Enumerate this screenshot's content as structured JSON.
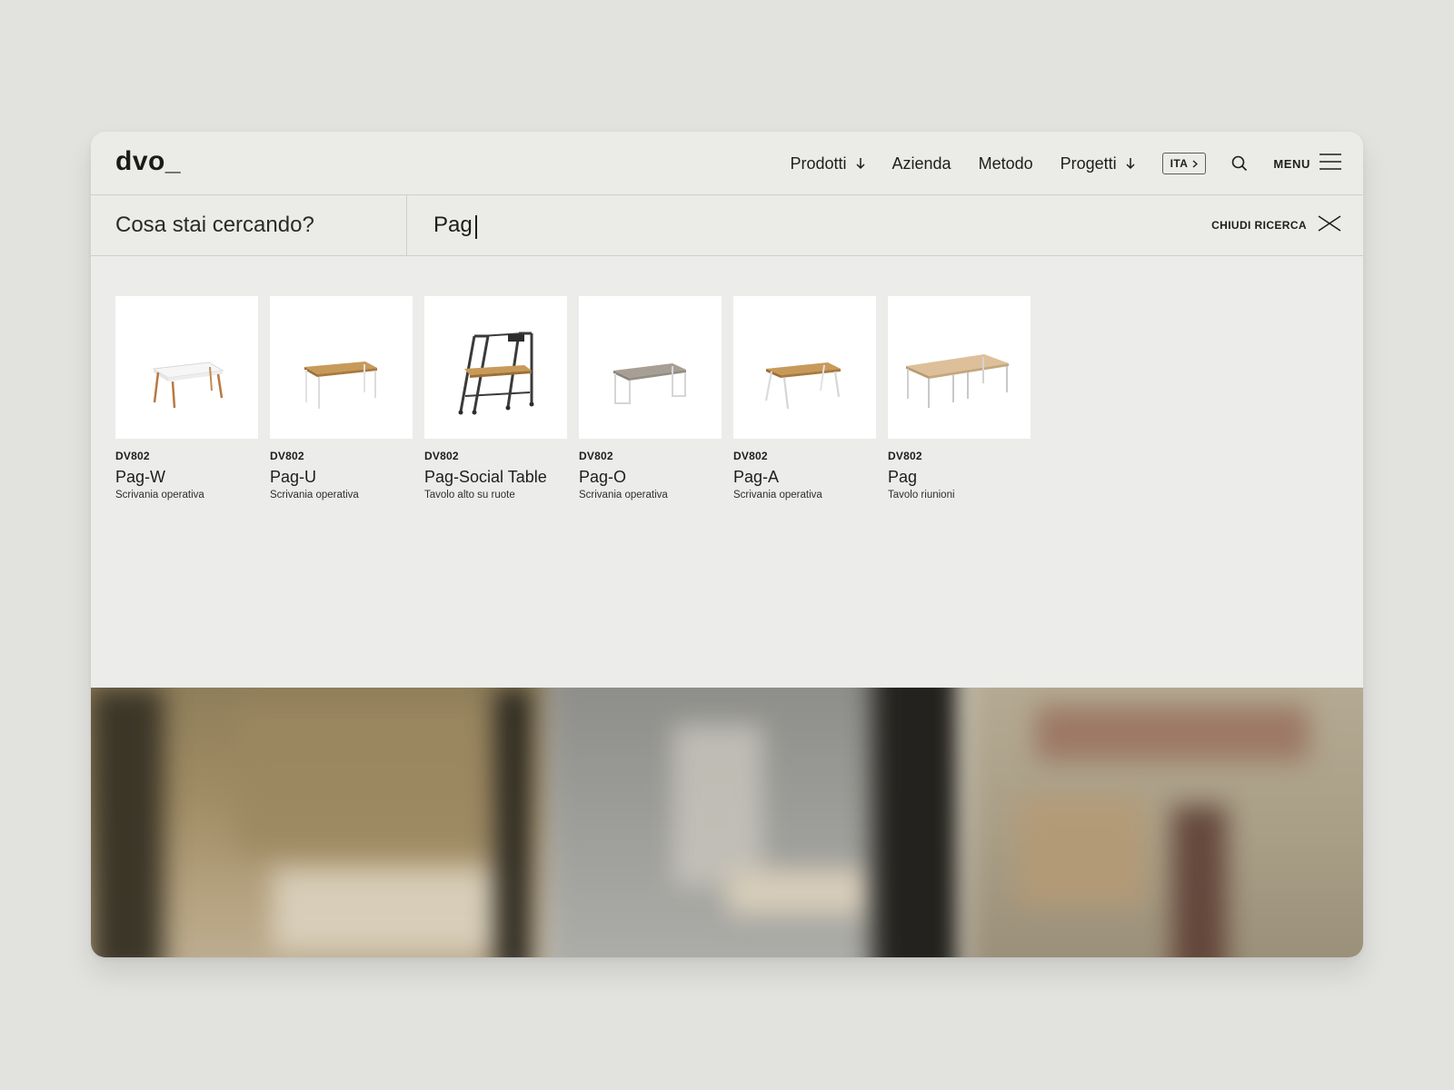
{
  "brand": {
    "logo": "dvo_"
  },
  "nav": {
    "items": [
      {
        "label": "Prodotti",
        "has_dropdown": true,
        "icon": "arrow-down-icon"
      },
      {
        "label": "Azienda",
        "has_dropdown": false
      },
      {
        "label": "Metodo",
        "has_dropdown": false
      },
      {
        "label": "Progetti",
        "has_dropdown": true,
        "icon": "arrow-down-icon"
      }
    ],
    "language": "ITA",
    "search_icon": "search-icon",
    "menu_label": "MENU",
    "menu_icon": "hamburger-icon"
  },
  "search": {
    "prompt": "Cosa stai cercando?",
    "query": "Pag",
    "close_label": "CHIUDI RICERCA",
    "close_icon": "close-icon"
  },
  "results": [
    {
      "code": "DV802",
      "name": "Pag-W",
      "description": "Scrivania operativa",
      "image": "white-desk-wooden-legs"
    },
    {
      "code": "DV802",
      "name": "Pag-U",
      "description": "Scrivania operativa",
      "image": "oak-desk-white-frame"
    },
    {
      "code": "DV802",
      "name": "Pag-Social Table",
      "description": "Tavolo alto su ruote",
      "image": "tall-table-on-wheels"
    },
    {
      "code": "DV802",
      "name": "Pag-O",
      "description": "Scrivania operativa",
      "image": "grey-desk-loop-legs"
    },
    {
      "code": "DV802",
      "name": "Pag-A",
      "description": "Scrivania operativa",
      "image": "oak-desk-slanted-legs"
    },
    {
      "code": "DV802",
      "name": "Pag",
      "description": "Tavolo riunioni",
      "image": "meeting-table"
    }
  ],
  "colors": {
    "page_bg": "#e2e2df",
    "panel_bg": "#ebebe7",
    "text": "#1d1d1b",
    "divider": "#cfcfca"
  }
}
